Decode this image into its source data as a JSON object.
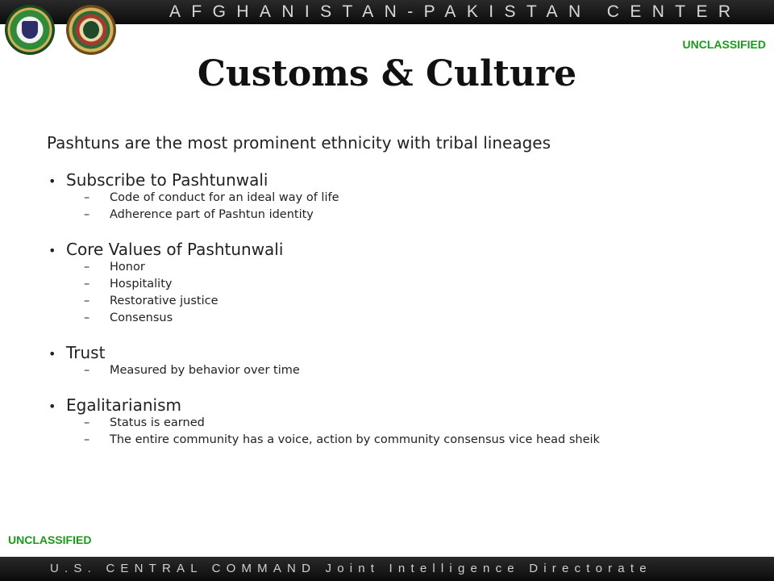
{
  "header": {
    "title": "AFGHANISTAN-PAKISTAN CENTER"
  },
  "classification": {
    "top": "UNCLASSIFIED",
    "bottom": "UNCLASSIFIED"
  },
  "slide": {
    "title": "Customs & Culture",
    "intro": "Pashtuns are the most prominent ethnicity with tribal lineages",
    "bullets": [
      {
        "text": "Subscribe to Pashtunwali",
        "subs": [
          "Code of conduct for an ideal way of life",
          "Adherence part of Pashtun identity"
        ]
      },
      {
        "text": "Core Values of Pashtunwali",
        "subs": [
          "Honor",
          "Hospitality",
          "Restorative justice",
          "Consensus"
        ]
      },
      {
        "text": "Trust",
        "subs": [
          "Measured by behavior over time"
        ]
      },
      {
        "text": "Egalitarianism",
        "subs": [
          "Status is earned",
          "The entire community has a voice, action by community consensus vice head sheik"
        ]
      }
    ]
  },
  "footer": {
    "text": "U.S. CENTRAL COMMAND Joint Intelligence Directorate"
  },
  "colors": {
    "classification": "#1a9a1a",
    "band": "#111111"
  }
}
